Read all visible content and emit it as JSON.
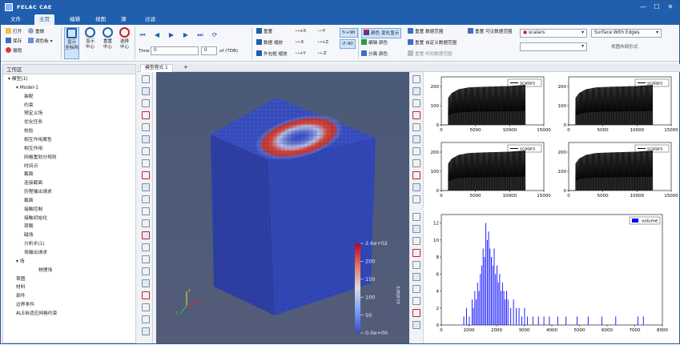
{
  "app": {
    "title": "FELAC CAE"
  },
  "window_controls": {
    "minimize": "—",
    "maximize": "☐",
    "close": "✕"
  },
  "menu_tabs": [
    {
      "label": "文件",
      "active": false
    },
    {
      "label": "主页",
      "active": true
    },
    {
      "label": "编辑",
      "active": false
    },
    {
      "label": "视图",
      "active": false
    },
    {
      "label": "源",
      "active": false
    },
    {
      "label": "过滤",
      "active": false
    }
  ],
  "ribbon": {
    "file": {
      "open": "打开",
      "save": "保存",
      "undo": "撤销",
      "redo": "重做",
      "shape": "调色板"
    },
    "view_buttons": [
      {
        "label1": "显示",
        "label2": "全标网",
        "selected": true
      },
      {
        "label1": "显示",
        "label2": "中心",
        "selected": false
      },
      {
        "label1": "重置",
        "label2": "中心",
        "selected": false
      },
      {
        "label1": "选择",
        "label2": "中心",
        "selected": false
      }
    ],
    "playback": {
      "time_label": "Time",
      "time_value": "0",
      "frame_value": "0",
      "of_label": "of (TDB)"
    },
    "camera_left": [
      "重置",
      "数据 缩放",
      "外包框 缩放"
    ],
    "camera_axes": {
      "col1": [
        "+X",
        "-X",
        "+Y"
      ],
      "col2": [
        "-Y",
        "+Z",
        "-Z"
      ],
      "rot": [
        "+90",
        "-90"
      ]
    },
    "coloring": {
      "toggle": "颜色 变化显示",
      "edit": "编辑 颜色",
      "separate": "分离 颜色"
    },
    "range": {
      "reset_data": "重置 数据范围",
      "reset_custom": "重置 自定义数据范围",
      "reset_time": "重置 时间数据范围",
      "reset_visible": "重置 可见数据范围"
    },
    "scalars_select": "scalars",
    "representation_select": "Surface With Edges",
    "representation_caption": "视图布局形式"
  },
  "tree": {
    "header": "工作区",
    "items": [
      {
        "label": "模型(1)",
        "level": 0
      },
      {
        "label": "Model-1",
        "level": 1
      },
      {
        "label": "装配",
        "level": 2
      },
      {
        "label": "约束",
        "level": 2
      },
      {
        "label": "预定义场",
        "level": 2
      },
      {
        "label": "优化任务",
        "level": 2
      },
      {
        "label": "校验",
        "level": 2
      },
      {
        "label": "相互作用属性",
        "level": 2
      },
      {
        "label": "相互作用",
        "level": 2
      },
      {
        "label": "网格重划分规则",
        "level": 2
      },
      {
        "label": "时间点",
        "level": 2
      },
      {
        "label": "截面",
        "level": 2
      },
      {
        "label": "连接截面",
        "level": 2
      },
      {
        "label": "历程输出请求",
        "level": 2
      },
      {
        "label": "截面",
        "level": 2
      },
      {
        "label": "接触控制",
        "level": 2
      },
      {
        "label": "接触初始化",
        "level": 2
      },
      {
        "label": "荷载",
        "level": 2
      },
      {
        "label": "磁场",
        "level": 2
      },
      {
        "label": "分析步(1)",
        "level": 2
      },
      {
        "label": "场输出请求",
        "level": 2
      },
      {
        "label": "场",
        "level": 1
      },
      {
        "label": "物理场",
        "level": 3
      },
      {
        "label": "草图",
        "level": 1
      },
      {
        "label": "材料",
        "level": 1
      },
      {
        "label": "部件",
        "level": 1
      },
      {
        "label": "边界条件",
        "level": 1
      },
      {
        "label": "ALE自适应网格约束",
        "level": 1
      }
    ]
  },
  "viewport_tab": {
    "label": "模型程式 1",
    "add": "+"
  },
  "colorbar": {
    "title": "scalars",
    "ticks": [
      "2.6e+02",
      "200",
      "150",
      "100",
      "50",
      "0.0e+00"
    ]
  },
  "axes_triad": {
    "x": "X",
    "y": "Y",
    "z": "Z"
  },
  "colors": {
    "accent": "#1f5fad",
    "mesh_blue": "#2f46b8",
    "hot_red": "#c5222a"
  },
  "chart_data": [
    {
      "type": "line",
      "legend": [
        "scalars"
      ],
      "legend_position": "top-right",
      "xlim": [
        0,
        15000
      ],
      "ylim": [
        0,
        250
      ],
      "xticks": [
        "0",
        "5000",
        "10000",
        "15000"
      ],
      "yticks": [
        "0",
        "100",
        "200"
      ],
      "envelope": {
        "x": [
          1000,
          1500,
          2500,
          4000,
          6000,
          8000,
          10000,
          11000,
          12300
        ],
        "y": [
          140,
          165,
          185,
          195,
          198,
          200,
          202,
          205,
          208
        ]
      },
      "cycles": 30
    },
    {
      "type": "line",
      "legend": [
        "scalars"
      ],
      "legend_position": "top-right",
      "xlim": [
        0,
        15000
      ],
      "ylim": [
        0,
        250
      ],
      "xticks": [
        "0",
        "5000",
        "10000",
        "15000"
      ],
      "yticks": [
        "0",
        "100",
        "200"
      ],
      "envelope": {
        "x": [
          1000,
          1500,
          2500,
          4000,
          6000,
          8000,
          10000,
          11000,
          12300
        ],
        "y": [
          140,
          165,
          185,
          195,
          198,
          200,
          202,
          205,
          208
        ]
      },
      "cycles": 30
    },
    {
      "type": "line",
      "legend": [
        "scalars"
      ],
      "legend_position": "top-right",
      "xlim": [
        0,
        15000
      ],
      "ylim": [
        0,
        250
      ],
      "xticks": [
        "0",
        "5000",
        "10000",
        "15000"
      ],
      "yticks": [
        "0",
        "100",
        "200"
      ],
      "envelope": {
        "x": [
          1000,
          1500,
          2500,
          4000,
          6000,
          8000,
          10000,
          11000,
          12300
        ],
        "y": [
          140,
          165,
          185,
          195,
          198,
          200,
          202,
          205,
          208
        ]
      },
      "cycles": 30
    },
    {
      "type": "line",
      "legend": [
        "scalars"
      ],
      "legend_position": "top-right",
      "xlim": [
        0,
        15000
      ],
      "ylim": [
        0,
        250
      ],
      "xticks": [
        "0",
        "5000",
        "10000",
        "15000"
      ],
      "yticks": [
        "0",
        "100",
        "200"
      ],
      "envelope": {
        "x": [
          1000,
          1500,
          2500,
          4000,
          6000,
          8000,
          10000,
          11000,
          12300
        ],
        "y": [
          140,
          165,
          185,
          195,
          198,
          200,
          202,
          205,
          208
        ]
      },
      "cycles": 30
    },
    {
      "type": "bar",
      "legend": [
        "volume"
      ],
      "legend_position": "top-right",
      "xlim": [
        0,
        8000
      ],
      "ylim": [
        0,
        13
      ],
      "xticks": [
        "0",
        "1000",
        "2000",
        "3000",
        "4000",
        "5000",
        "6000",
        "7000",
        "8000"
      ],
      "yticks": [
        "0",
        "2",
        "4",
        "6",
        "8",
        "10",
        "12"
      ],
      "bin_width": 25,
      "bins_x": [
        800,
        900,
        1000,
        1100,
        1150,
        1200,
        1250,
        1300,
        1350,
        1400,
        1450,
        1500,
        1550,
        1600,
        1650,
        1700,
        1750,
        1800,
        1850,
        1900,
        1950,
        2000,
        2050,
        2100,
        2150,
        2200,
        2250,
        2300,
        2350,
        2400,
        2500,
        2600,
        2700,
        2800,
        2900,
        3000,
        3100,
        3300,
        3500,
        3700,
        3900,
        4200,
        4500,
        4900,
        5300,
        5800,
        6300,
        7100,
        7300
      ],
      "counts": [
        1,
        2,
        1,
        3,
        2,
        4,
        3,
        5,
        4,
        6,
        7,
        9,
        8,
        12,
        10,
        11,
        9,
        8,
        7,
        9,
        6,
        7,
        5,
        6,
        4,
        5,
        4,
        3,
        4,
        3,
        2,
        3,
        2,
        2,
        1,
        2,
        1,
        1,
        1,
        1,
        1,
        1,
        1,
        1,
        1,
        1,
        1,
        1,
        1
      ]
    }
  ]
}
